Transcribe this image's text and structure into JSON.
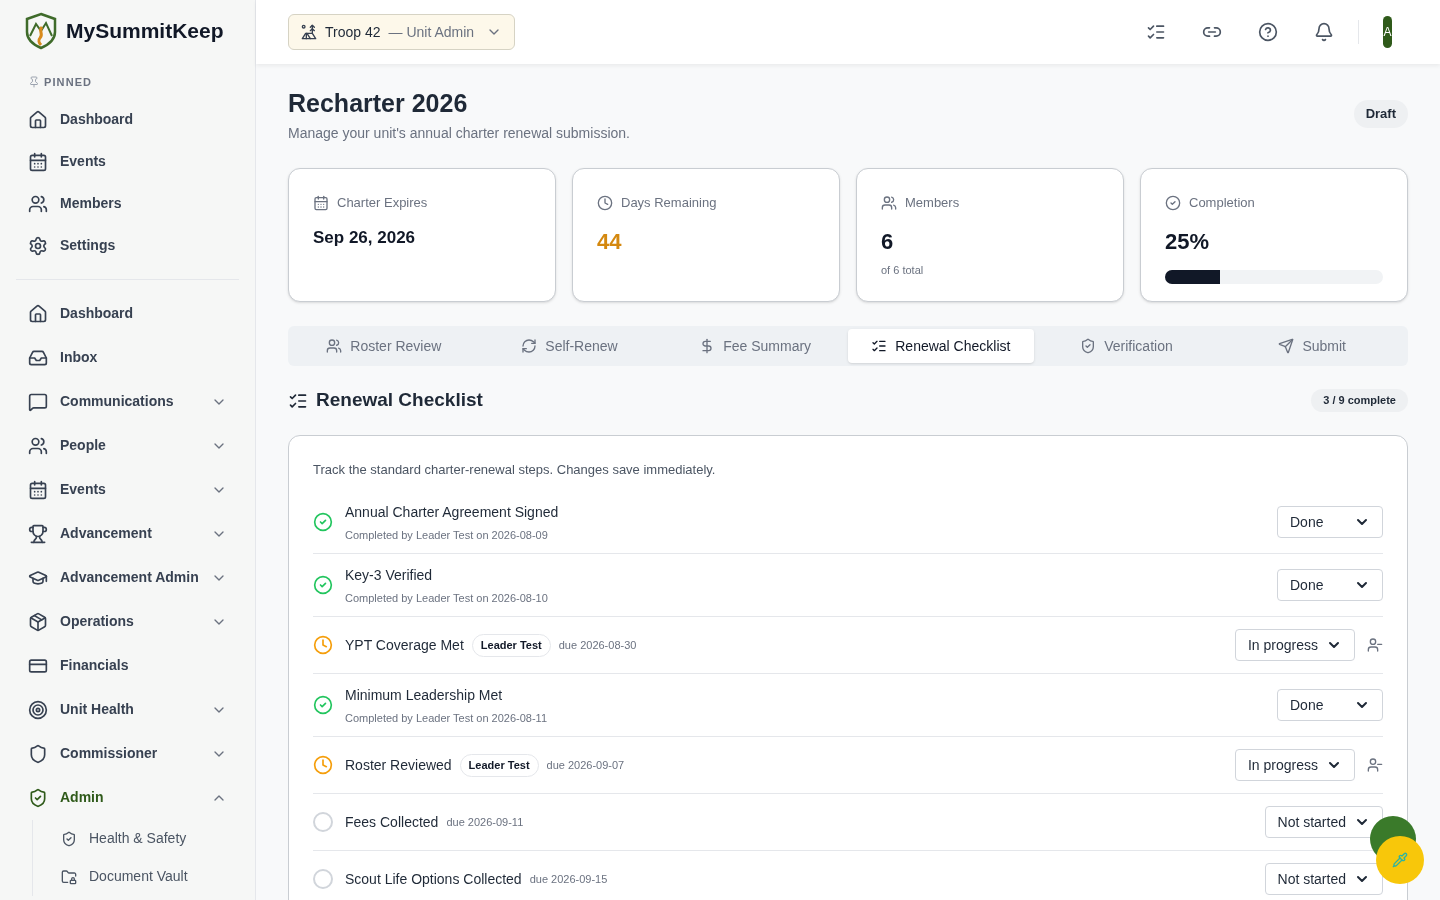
{
  "brand": {
    "name": "MySummitKeep"
  },
  "sidebar": {
    "pinned_label": "PINNED",
    "pinned": [
      {
        "label": "Dashboard"
      },
      {
        "label": "Events"
      },
      {
        "label": "Members"
      },
      {
        "label": "Settings"
      }
    ],
    "items": [
      {
        "label": "Dashboard",
        "kind": "link"
      },
      {
        "label": "Inbox",
        "kind": "link"
      },
      {
        "label": "Communications",
        "kind": "group",
        "expanded": false,
        "selected": false
      },
      {
        "label": "People",
        "kind": "group",
        "expanded": false,
        "selected": false
      },
      {
        "label": "Events",
        "kind": "group",
        "expanded": false,
        "selected": false
      },
      {
        "label": "Advancement",
        "kind": "group",
        "expanded": false,
        "selected": false
      },
      {
        "label": "Advancement Admin",
        "kind": "group",
        "expanded": false,
        "selected": false
      },
      {
        "label": "Operations",
        "kind": "group",
        "expanded": false,
        "selected": false
      },
      {
        "label": "Financials",
        "kind": "link"
      },
      {
        "label": "Unit Health",
        "kind": "group",
        "expanded": false,
        "selected": false
      },
      {
        "label": "Commissioner",
        "kind": "group",
        "expanded": false,
        "selected": false
      },
      {
        "label": "Admin",
        "kind": "group",
        "expanded": true,
        "selected": true,
        "children": [
          {
            "label": "Health & Safety"
          },
          {
            "label": "Document Vault"
          }
        ]
      }
    ]
  },
  "header": {
    "unit_selector": {
      "unit": "Troop 42",
      "role": "— Unit Admin"
    },
    "avatar": "A"
  },
  "page": {
    "title": "Recharter 2026",
    "subtitle": "Manage your unit's annual charter renewal submission.",
    "status_badge": "Draft"
  },
  "stats": [
    {
      "kind": "text",
      "label": "Charter Expires",
      "value": "Sep 26, 2026"
    },
    {
      "kind": "warning",
      "label": "Days Remaining",
      "value": "44"
    },
    {
      "kind": "text",
      "label": "Members",
      "value": "6",
      "note": "of 6 total"
    },
    {
      "kind": "progress",
      "label": "Completion",
      "value": "25%",
      "level": 0.25
    }
  ],
  "tabs": [
    {
      "label": "Roster Review",
      "selected": false
    },
    {
      "label": "Self-Renew",
      "selected": false
    },
    {
      "label": "Fee Summary",
      "selected": false
    },
    {
      "label": "Renewal Checklist",
      "selected": true
    },
    {
      "label": "Verification",
      "selected": false
    },
    {
      "label": "Submit",
      "selected": false
    }
  ],
  "checklist": {
    "title": "Renewal Checklist",
    "count": "3 / 9 complete",
    "intro": "Track the standard charter-renewal steps. Changes save immediately.",
    "items": [
      {
        "title": "Annual Charter Agreement Signed",
        "kind": "done",
        "status_label": "Done",
        "completed": "Completed by Leader Test on 2026-08-09"
      },
      {
        "title": "Key-3 Verified",
        "kind": "done",
        "status_label": "Done",
        "completed": "Completed by Leader Test on 2026-08-10"
      },
      {
        "title": "YPT Coverage Met",
        "kind": "progress",
        "status_label": "In progress",
        "assignee": "Leader Test",
        "due": "due 2026-08-30"
      },
      {
        "title": "Minimum Leadership Met",
        "kind": "done",
        "status_label": "Done",
        "completed": "Completed by Leader Test on 2026-08-11"
      },
      {
        "title": "Roster Reviewed",
        "kind": "progress",
        "status_label": "In progress",
        "assignee": "Leader Test",
        "due": "due 2026-09-07"
      },
      {
        "title": "Fees Collected",
        "kind": "open",
        "status_label": "Not started",
        "due": "due 2026-09-11"
      },
      {
        "title": "Scout Life Options Collected",
        "kind": "open",
        "status_label": "Not started",
        "due": "due 2026-09-15"
      }
    ]
  }
}
